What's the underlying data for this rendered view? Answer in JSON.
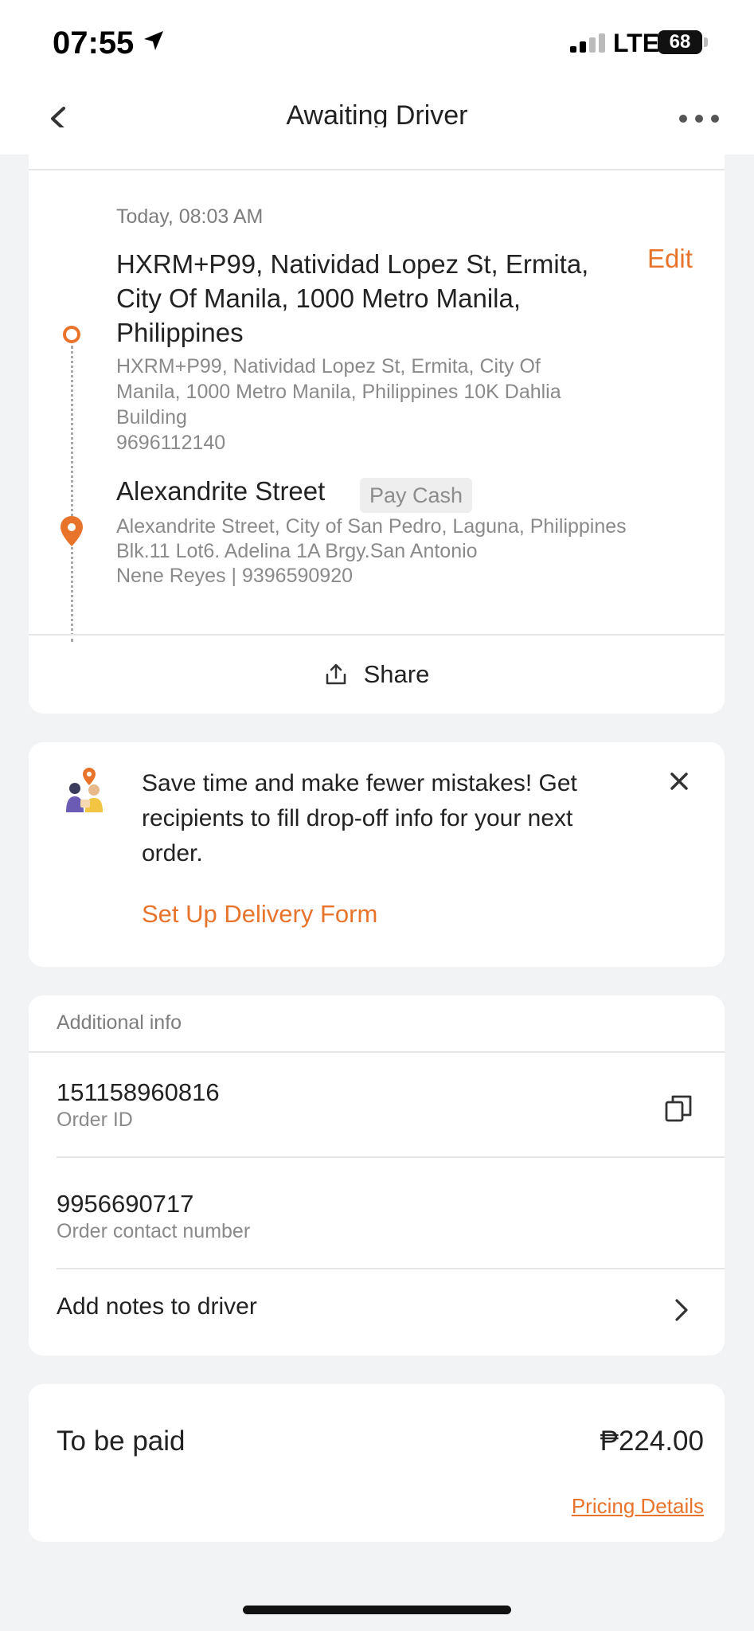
{
  "status_bar": {
    "time": "07:55",
    "network": "LTE",
    "battery": "68"
  },
  "header": {
    "title": "Awaiting Driver"
  },
  "route": {
    "scheduled_time": "Today, 08:03 AM",
    "edit_label": "Edit",
    "pickup": {
      "title": "HXRM+P99, Natividad Lopez St, Ermita, City Of Manila, 1000 Metro Manila, Philippines",
      "address_line1": "HXRM+P99, Natividad Lopez St, Ermita, City Of",
      "address_line2": "Manila, 1000 Metro Manila, Philippines 10K Dahlia",
      "address_line3": "Building",
      "phone": "9696112140"
    },
    "dropoff": {
      "title": "Alexandrite Street",
      "payment_badge": "Pay Cash",
      "address": "Alexandrite Street, City of San Pedro, Laguna, Philippines",
      "address_detail": "Blk.11 Lot6. Adelina 1A Brgy.San Antonio",
      "contact": "Nene Reyes  |  9396590920"
    },
    "share_label": "Share"
  },
  "promo": {
    "text": "Save time and make fewer mistakes! Get recipients to fill drop-off info for your next order.",
    "link": "Set Up Delivery Form"
  },
  "additional_info": {
    "header": "Additional info",
    "order_id": "151158960816",
    "order_id_label": "Order ID",
    "contact_number": "9956690717",
    "contact_number_label": "Order contact number",
    "notes_label": "Add notes to driver"
  },
  "payment": {
    "label": "To be paid",
    "amount": "₱224.00",
    "details_link": "Pricing Details"
  },
  "colors": {
    "accent": "#e8742c",
    "background": "#f2f3f5",
    "card": "#ffffff"
  },
  "icons": [
    "location-arrow-icon",
    "signal-icon",
    "battery-icon",
    "back-chevron-icon",
    "more-dots-icon",
    "share-icon",
    "delivery-illustration-icon",
    "close-icon",
    "copy-icon",
    "chevron-right-icon",
    "pickup-dot-icon",
    "dropoff-pin-icon"
  ]
}
